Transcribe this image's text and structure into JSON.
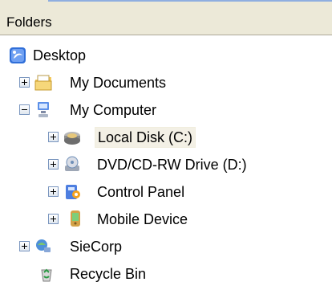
{
  "header": {
    "title": "Folders"
  },
  "tree": [
    {
      "id": "desktop",
      "label": "Desktop",
      "icon": "desktop-icon",
      "expander": "none"
    },
    {
      "id": "my-documents",
      "label": "My Documents",
      "icon": "folder-documents-icon",
      "expander": "plus"
    },
    {
      "id": "my-computer",
      "label": "My Computer",
      "icon": "computer-icon",
      "expander": "minus"
    },
    {
      "id": "local-disk",
      "label": "Local Disk (C:)",
      "icon": "hard-drive-icon",
      "expander": "plus",
      "selected": true
    },
    {
      "id": "dvd-drive",
      "label": "DVD/CD-RW Drive (D:)",
      "icon": "dvd-drive-icon",
      "expander": "plus"
    },
    {
      "id": "control-panel",
      "label": "Control Panel",
      "icon": "control-panel-icon",
      "expander": "plus"
    },
    {
      "id": "mobile-device",
      "label": "Mobile Device",
      "icon": "mobile-device-icon",
      "expander": "plus"
    },
    {
      "id": "siecorp",
      "label": "SieCorp",
      "icon": "network-icon",
      "expander": "plus"
    },
    {
      "id": "recycle-bin",
      "label": "Recycle Bin",
      "icon": "recycle-bin-icon",
      "expander": "none"
    }
  ]
}
